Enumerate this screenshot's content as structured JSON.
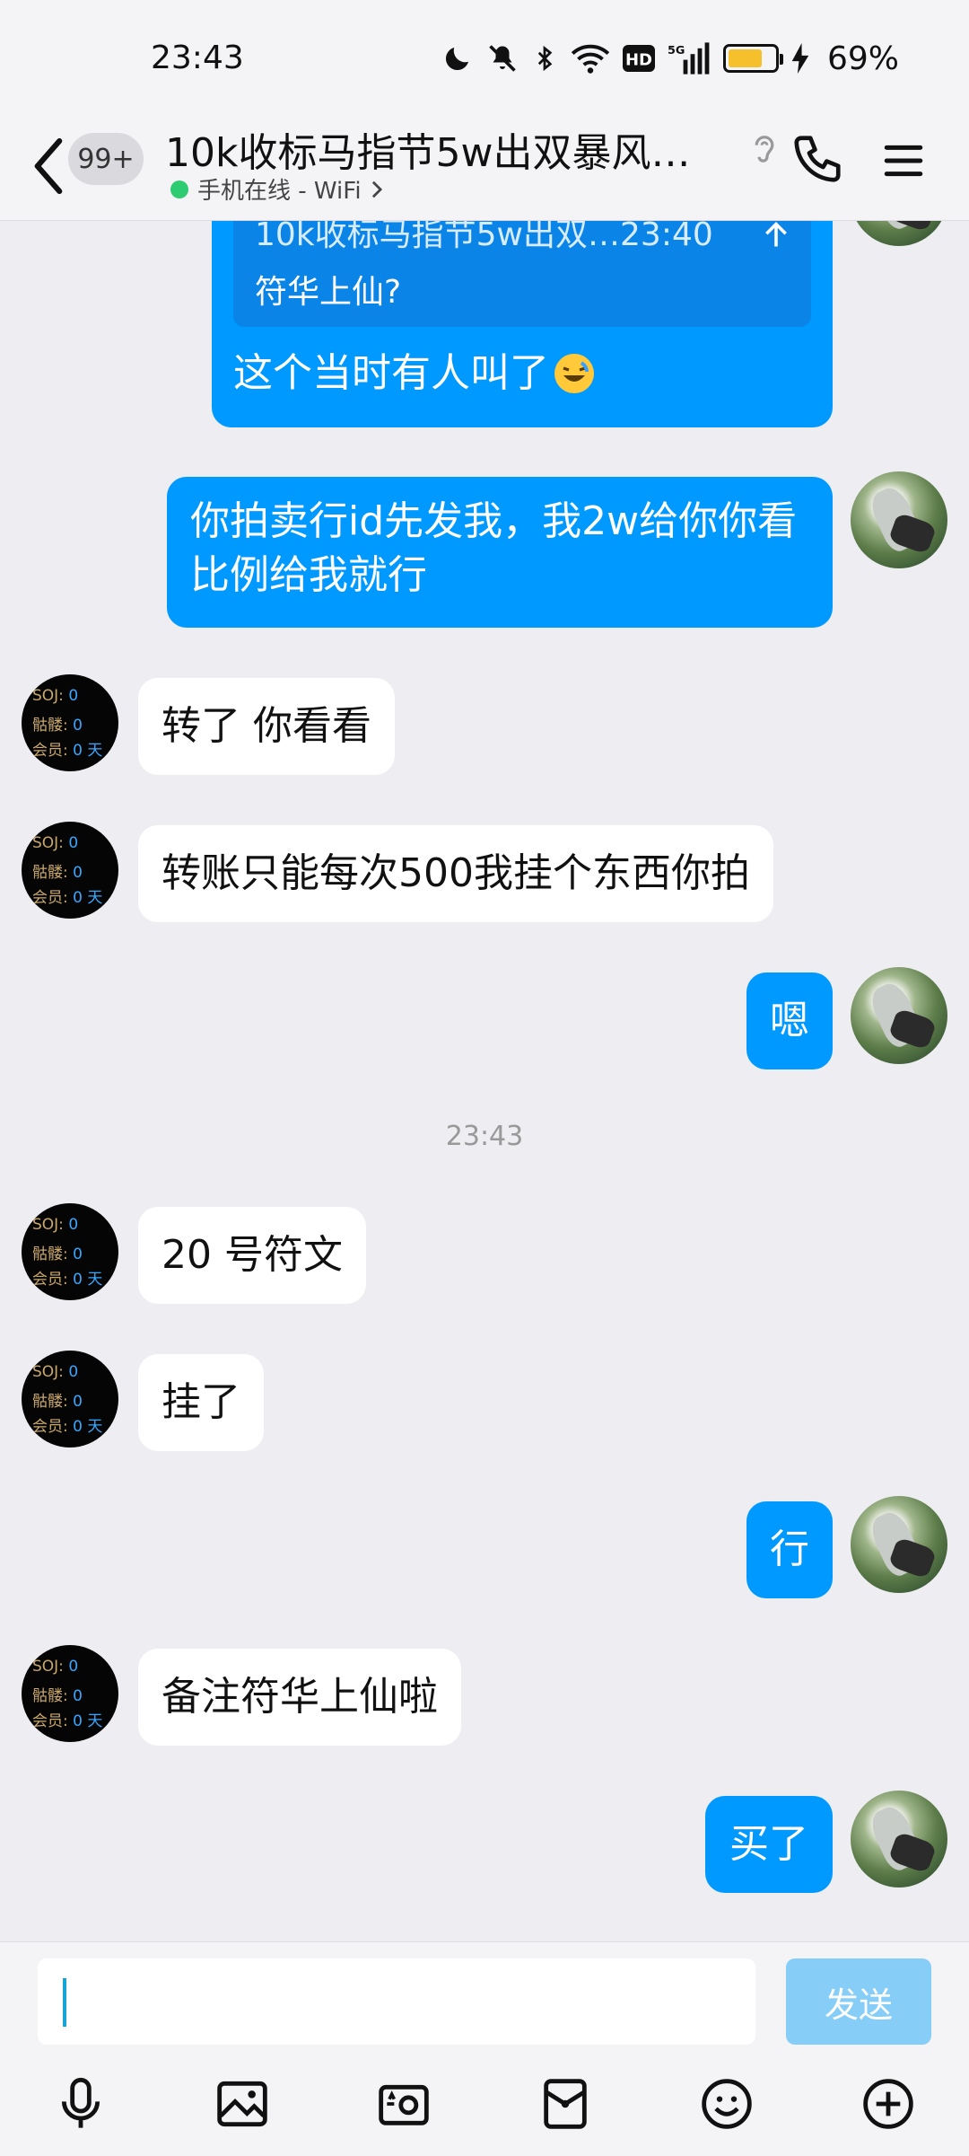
{
  "status_bar": {
    "time": "23:43",
    "network": "5G",
    "hd": "HD",
    "battery_pct": "69%",
    "battery_level": 0.69
  },
  "header": {
    "unread_badge": "99+",
    "title": "10k收标马指节5w出双暴风板…",
    "subtitle": "手机在线 - WiFi"
  },
  "avatar_other": {
    "rows": [
      {
        "label": "SOJ:",
        "value": "0"
      },
      {
        "label": "骷髅:",
        "value": "0"
      },
      {
        "label": "会员:",
        "value": "0 天"
      }
    ]
  },
  "quoted_message": {
    "header": "10k收标马指节5w出双…23:40",
    "text": "符华上仙?",
    "reply": "这个当时有人叫了"
  },
  "messages": [
    {
      "side": "me",
      "text": "你拍卖行id先发我，我2w给你你看比例给我就行"
    },
    {
      "side": "other",
      "text": "转了 你看看"
    },
    {
      "side": "other",
      "text": "转账只能每次500我挂个东西你拍"
    },
    {
      "side": "me",
      "text": "嗯"
    },
    {
      "side": "other",
      "text": "20 号符文"
    },
    {
      "side": "other",
      "text": "挂了"
    },
    {
      "side": "me",
      "text": "行"
    },
    {
      "side": "other",
      "text": "备注符华上仙啦"
    },
    {
      "side": "me",
      "text": "买了"
    }
  ],
  "timestamp": "23:43",
  "input": {
    "value": "",
    "send_label": "发送"
  },
  "colors": {
    "bubble_me": "#0099ff",
    "bubble_other": "#ffffff",
    "background": "#ededf2",
    "send_disabled": "#86cdf7"
  },
  "toolbar_icons": [
    "microphone-icon",
    "image-icon",
    "camera-icon",
    "red-packet-icon",
    "emoji-icon",
    "plus-icon"
  ]
}
